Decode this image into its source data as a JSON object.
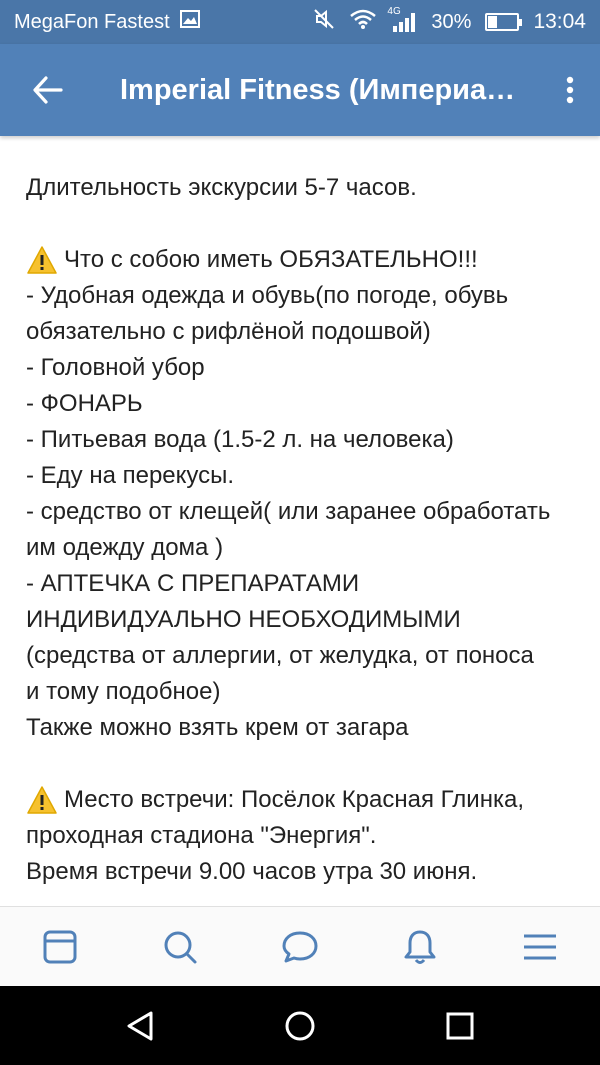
{
  "status_bar": {
    "carrier": "MegaFon Fastest",
    "network": "4G",
    "battery": "30%",
    "battery_level": 0.3,
    "time": "13:04"
  },
  "app_bar": {
    "title": "Imperial Fitness (Империал)..."
  },
  "post": {
    "duration": "Длительность экскурсии 5-7 часов.",
    "must_have_heading": "Что с собою иметь ОБЯЗАТЕЛЬНО!!!",
    "must_have_lines": [
      "- Удобная одежда и обувь(по погоде, обувь",
      "обязательно с рифлёной подошвой)",
      "- Головной убор",
      "- ФОНАРЬ",
      "- Питьевая вода (1.5-2 л. на человека)",
      "- Еду на перекусы.",
      "- средство от клещей( или заранее обработать",
      "им одежду дома )",
      "- АПТЕЧКА С ПРЕПАРАТАМИ",
      "ИНДИВИДУАЛЬНО НЕОБХОДИМЫМИ",
      "(средства от аллергии, от желудка, от поноса",
      "и тому подобное)",
      "Также можно взять крем от загара"
    ],
    "meeting_heading": "Место встречи: Посёлок Красная Глинка,",
    "meeting_lines": [
      "проходная стадиона \"Энергия\".",
      "Время встречи 9.00 часов утра 30 июня."
    ]
  },
  "bottom_nav": {
    "items": [
      "news-icon",
      "search-icon",
      "messages-icon",
      "notifications-icon",
      "menu-icon"
    ]
  },
  "colors": {
    "status_bar": "#4a76a8",
    "app_bar": "#5181b8",
    "nav_icon": "#5181b8",
    "warning": "#f6c12e"
  }
}
